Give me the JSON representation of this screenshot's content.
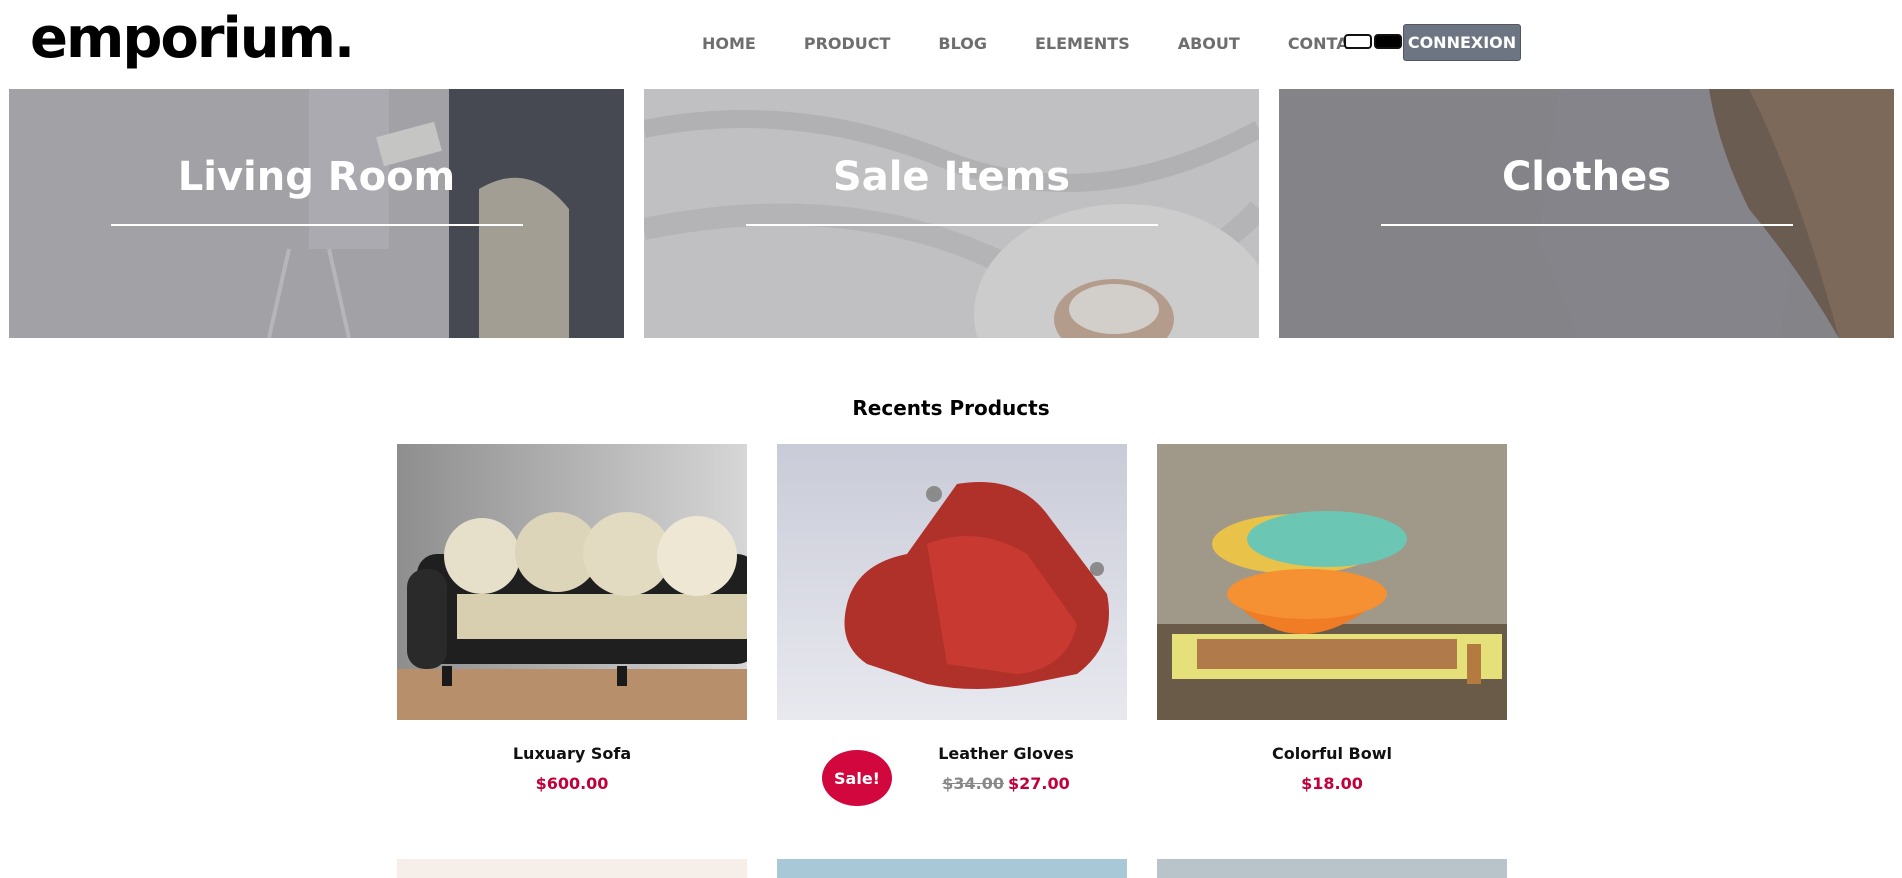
{
  "header": {
    "logo": "emporium.",
    "nav": [
      "HOME",
      "PRODUCT",
      "BLOG",
      "ELEMENTS",
      "ABOUT",
      "CONTACT"
    ],
    "login_label": "CONNEXION"
  },
  "banners": [
    {
      "title": "Living Room"
    },
    {
      "title": "Sale Items"
    },
    {
      "title": "Clothes"
    }
  ],
  "recent": {
    "title": "Recents Products",
    "products": [
      {
        "name": "Luxuary Sofa",
        "price": "$600.00"
      },
      {
        "name": "Leather Gloves",
        "old_price": "$34.00",
        "price": "$27.00",
        "badge": "Sale!"
      },
      {
        "name": "Colorful Bowl",
        "price": "$18.00"
      }
    ]
  },
  "colors": {
    "accent": "#c2003b",
    "sale_badge": "#d1073e",
    "button": "#6c7581"
  }
}
